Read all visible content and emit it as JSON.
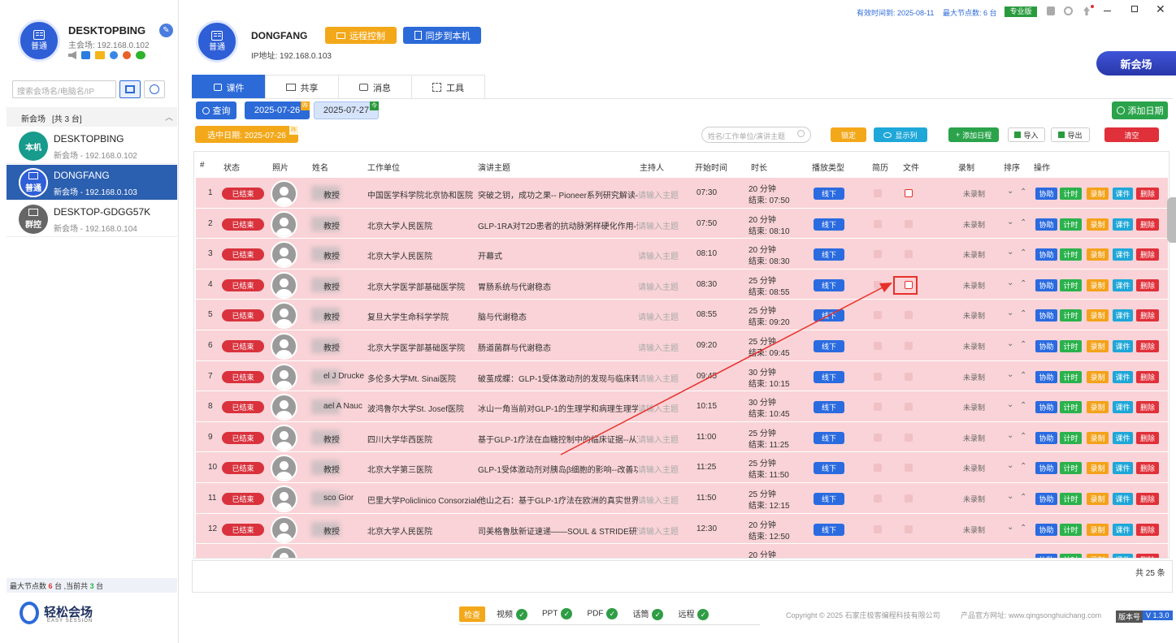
{
  "sidebar": {
    "self_name": "DESKTOPBING",
    "self_ip": "主会场: 192.168.0.102",
    "self_badge": "普通",
    "search_placeholder": "搜索会场名/电脑名/IP",
    "group_title": "新会场",
    "group_count": "[共 3 台]",
    "nodes": [
      {
        "badge": "本机",
        "name": "DESKTOPBING",
        "ip": "新会场 - 192.168.0.102",
        "color": "#169b8c"
      },
      {
        "badge": "普通",
        "name": "DONGFANG",
        "ip": "新会场 - 192.168.0.103",
        "color": "#2f5fd6"
      },
      {
        "badge": "群控",
        "name": "DESKTOP-GDGG57K",
        "ip": "新会场 - 192.168.0.104",
        "color": "#666666"
      }
    ],
    "footer_prefix": "最大节点数",
    "footer_max": "6",
    "footer_mid": "台 ,当前共",
    "footer_cur": "3",
    "footer_suffix": "台",
    "logo_text": "轻松会场",
    "logo_sub": "EASY SESSION"
  },
  "header": {
    "device_name": "DONGFANG",
    "device_badge": "普通",
    "ip_label": "IP地址: 192.168.0.103",
    "remote_btn": "远程控制",
    "sync_btn": "同步到本机",
    "valid_until": "有效时间到: 2025-08-11",
    "max_nodes": "最大节点数: 6 台",
    "edition": "专业版",
    "new_venue": "新会场"
  },
  "tabs": [
    "课件",
    "共享",
    "消息",
    "工具"
  ],
  "toolbar": {
    "query": "查询",
    "date1": "2025-07-26",
    "date1_tag": "昨",
    "date2": "2025-07-27",
    "date2_tag": "今",
    "add_date": "添加日期",
    "selected_date": "选中日期: 2025-07-26",
    "selected_tag": "昨",
    "search_placeholder": "姓名/工作单位/演讲主题",
    "lock": "锁定",
    "show_cols": "显示列",
    "add_schedule": "添加日程",
    "import": "导入",
    "export": "导出",
    "clear": "清空"
  },
  "columns": [
    "#",
    "状态",
    "照片",
    "姓名",
    "工作单位",
    "演讲主题",
    "主持人",
    "开始时间",
    "时长",
    "播放类型",
    "简历",
    "文件",
    "录制",
    "排序",
    "操作"
  ],
  "rows": [
    {
      "n": "1",
      "status": "已结束",
      "name": "教授",
      "org": "中国医学科学院北京协和医院",
      "topic": "突破之钥，成功之果-- Pioneer系列研究解读-诺和",
      "host": "请输入主题",
      "start": "07:30",
      "dur": "20 分钟",
      "end": "结束: 07:50",
      "type": "线下",
      "rec": "未录制"
    },
    {
      "n": "2",
      "status": "已结束",
      "name": "教授",
      "org": "北京大学人民医院",
      "topic": "GLP-1RA对T2D患者的抗动脉粥样硬化作用-诺和",
      "host": "请输入主题",
      "start": "07:50",
      "dur": "20 分钟",
      "end": "结束: 08:10",
      "type": "线下",
      "rec": "未录制"
    },
    {
      "n": "3",
      "status": "已结束",
      "name": "教授",
      "org": "北京大学人民医院",
      "topic": "开幕式",
      "host": "请输入主题",
      "start": "08:10",
      "dur": "20 分钟",
      "end": "结束: 08:30",
      "type": "线下",
      "rec": "未录制"
    },
    {
      "n": "4",
      "status": "已结束",
      "name": "教授",
      "org": "北京大学医学部基础医学院",
      "topic": "胃肠系统与代谢稳态",
      "host": "请输入主题",
      "start": "08:30",
      "dur": "25 分钟",
      "end": "结束: 08:55",
      "type": "线下",
      "rec": "未录制"
    },
    {
      "n": "5",
      "status": "已结束",
      "name": "教授",
      "org": "复旦大学生命科学学院",
      "topic": "脑与代谢稳态",
      "host": "请输入主题",
      "start": "08:55",
      "dur": "25 分钟",
      "end": "结束: 09:20",
      "type": "线下",
      "rec": "未录制"
    },
    {
      "n": "6",
      "status": "已结束",
      "name": "教授",
      "org": "北京大学医学部基础医学院",
      "topic": "肠道菌群与代谢稳态",
      "host": "请输入主题",
      "start": "09:20",
      "dur": "25 分钟",
      "end": "结束: 09:45",
      "type": "线下",
      "rec": "未录制"
    },
    {
      "n": "7",
      "status": "已结束",
      "name": "el J Drucke",
      "org": "多伦多大学Mt. Sinai医院",
      "topic": "破茧成蝶：GLP-1受体激动剂的发现与临床转化",
      "host": "请输入主题",
      "start": "09:45",
      "dur": "30 分钟",
      "end": "结束: 10:15",
      "type": "线下",
      "rec": "未录制"
    },
    {
      "n": "8",
      "status": "已结束",
      "name": "ael A Nauc",
      "org": "波鸿鲁尔大学St. Josef医院",
      "topic": "冰山一角当前对GLP-1的生理学和病理生理学认知",
      "host": "请输入主题",
      "start": "10:15",
      "dur": "30 分钟",
      "end": "结束: 10:45",
      "type": "线下",
      "rec": "未录制"
    },
    {
      "n": "9",
      "status": "已结束",
      "name": "教授",
      "org": "四川大学华西医院",
      "topic": "基于GLP-1疗法在血糖控制中的临床证据--从艾塞",
      "host": "请输入主题",
      "start": "11:00",
      "dur": "25 分钟",
      "end": "结束: 11:25",
      "type": "线下",
      "rec": "未录制"
    },
    {
      "n": "10",
      "status": "已结束",
      "name": "教授",
      "org": "北京大学第三医院",
      "topic": "GLP-1受体激动剂对胰岛β细胞的影响--改善功能",
      "host": "请输入主题",
      "start": "11:25",
      "dur": "25 分钟",
      "end": "结束: 11:50",
      "type": "线下",
      "rec": "未录制"
    },
    {
      "n": "11",
      "status": "已结束",
      "name": "sco Gior",
      "org": "巴里大学Policlinico Consorziale",
      "topic": "他山之石：基于GLP-1疗法在欧洲的真实世界研究",
      "host": "请输入主题",
      "start": "11:50",
      "dur": "25 分钟",
      "end": "结束: 12:15",
      "type": "线下",
      "rec": "未录制"
    },
    {
      "n": "12",
      "status": "已结束",
      "name": "教授",
      "org": "北京大学人民医院",
      "topic": "司美格鲁肽新证速递——SOUL & STRIDE研究解",
      "host": "请输入主题",
      "start": "12:30",
      "dur": "20 分钟",
      "end": "结束: 12:50",
      "type": "线下",
      "rec": "未录制"
    },
    {
      "n": "",
      "status": "",
      "name": "",
      "org": "",
      "topic": "",
      "host": "",
      "start": "",
      "dur": "20 分钟",
      "end": "",
      "type": "",
      "rec": ""
    }
  ],
  "ops": [
    "协助",
    "计时",
    "录制",
    "课件",
    "删除"
  ],
  "op_colors": [
    "#2b6be0",
    "#2bb24c",
    "#f3a21a",
    "#1ea7d8",
    "#e0303a"
  ],
  "total": "共 25 条",
  "footer": {
    "check": "检查",
    "items": [
      "视频",
      "PPT",
      "PDF",
      "话筒",
      "远程"
    ],
    "copyright": "Copyright © 2025 石家庄极客编程科技有限公司",
    "site": "产品官方网址: www.qingsonghuichang.com",
    "ver_label": "版本号",
    "version": "V 1.3.0"
  }
}
